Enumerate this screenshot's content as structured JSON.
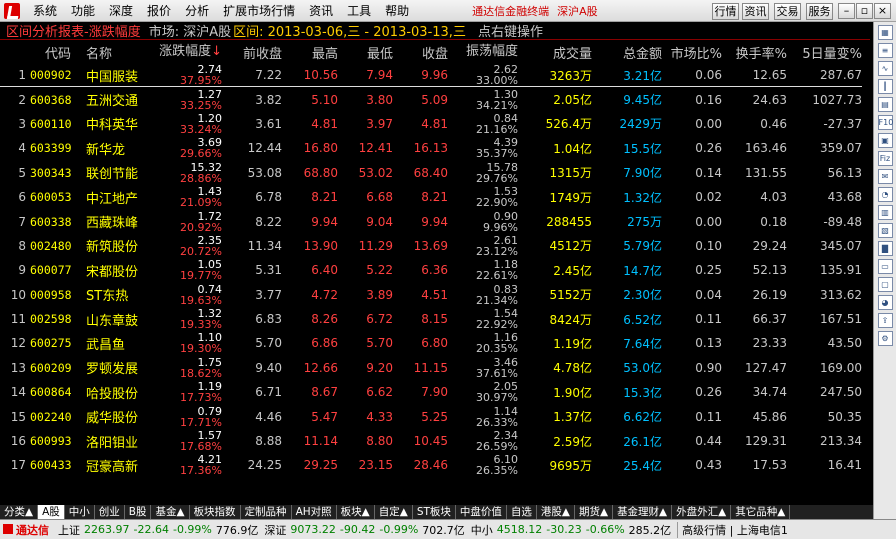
{
  "menu": {
    "items": [
      "系统",
      "功能",
      "深度",
      "报价",
      "分析",
      "扩展市场行情",
      "资讯",
      "工具",
      "帮助"
    ],
    "brand": "通达信金融终端",
    "market": "深沪A股",
    "buttons": [
      "行情",
      "资讯",
      "交易",
      "服务"
    ]
  },
  "title": {
    "main": "区间分析报表-涨跌幅度",
    "market": "市场: 深沪A股",
    "range": "区间: 2013-03-06,三 - 2013-03-13,三",
    "hint": "点右键操作"
  },
  "columns": {
    "code": "代码",
    "name": "名称",
    "pct": "涨跌幅度",
    "prev": "前收盘",
    "high": "最高",
    "low": "最低",
    "close": "收盘",
    "amp": "振荡幅度",
    "vol": "成交量",
    "amt": "总金额",
    "mkt": "市场比%",
    "turn": "换手率%",
    "d5": "5日量变%"
  },
  "rows": [
    {
      "idx": "1",
      "code": "000902",
      "name": "中国服装",
      "chg": "2.74",
      "pct": "37.95%",
      "prev": "7.22",
      "high": "10.56",
      "low": "7.94",
      "close": "9.96",
      "amp_abs": "2.62",
      "amp": "33.00%",
      "vol": "3263万",
      "amt": "3.21亿",
      "mkt": "0.06",
      "turn": "12.65",
      "d5": "287.67"
    },
    {
      "idx": "2",
      "code": "600368",
      "name": "五洲交通",
      "chg": "1.27",
      "pct": "33.25%",
      "prev": "3.82",
      "high": "5.10",
      "low": "3.80",
      "close": "5.09",
      "amp_abs": "1.30",
      "amp": "34.21%",
      "vol": "2.05亿",
      "amt": "9.45亿",
      "mkt": "0.16",
      "turn": "24.63",
      "d5": "1027.73"
    },
    {
      "idx": "3",
      "code": "600110",
      "name": "中科英华",
      "chg": "1.20",
      "pct": "33.24%",
      "prev": "3.61",
      "high": "4.81",
      "low": "3.97",
      "close": "4.81",
      "amp_abs": "0.84",
      "amp": "21.16%",
      "vol": "526.4万",
      "amt": "2429万",
      "mkt": "0.00",
      "turn": "0.46",
      "d5": "-27.37"
    },
    {
      "idx": "4",
      "code": "603399",
      "name": "新华龙",
      "chg": "3.69",
      "pct": "29.66%",
      "prev": "12.44",
      "high": "16.80",
      "low": "12.41",
      "close": "16.13",
      "amp_abs": "4.39",
      "amp": "35.37%",
      "vol": "1.04亿",
      "amt": "15.5亿",
      "mkt": "0.26",
      "turn": "163.46",
      "d5": "359.07"
    },
    {
      "idx": "5",
      "code": "300343",
      "name": "联创节能",
      "chg": "15.32",
      "pct": "28.86%",
      "prev": "53.08",
      "high": "68.80",
      "low": "53.02",
      "close": "68.40",
      "amp_abs": "15.78",
      "amp": "29.76%",
      "vol": "1315万",
      "amt": "7.90亿",
      "mkt": "0.14",
      "turn": "131.55",
      "d5": "56.13"
    },
    {
      "idx": "6",
      "code": "600053",
      "name": "中江地产",
      "chg": "1.43",
      "pct": "21.09%",
      "prev": "6.78",
      "high": "8.21",
      "low": "6.68",
      "close": "8.21",
      "amp_abs": "1.53",
      "amp": "22.90%",
      "vol": "1749万",
      "amt": "1.32亿",
      "mkt": "0.02",
      "turn": "4.03",
      "d5": "43.68"
    },
    {
      "idx": "7",
      "code": "600338",
      "name": "西藏珠峰",
      "chg": "1.72",
      "pct": "20.92%",
      "prev": "8.22",
      "high": "9.94",
      "low": "9.04",
      "close": "9.94",
      "amp_abs": "0.90",
      "amp": "9.96%",
      "vol": "288455",
      "amt": "275万",
      "mkt": "0.00",
      "turn": "0.18",
      "d5": "-89.48"
    },
    {
      "idx": "8",
      "code": "002480",
      "name": "新筑股份",
      "chg": "2.35",
      "pct": "20.72%",
      "prev": "11.34",
      "high": "13.90",
      "low": "11.29",
      "close": "13.69",
      "amp_abs": "2.61",
      "amp": "23.12%",
      "vol": "4512万",
      "amt": "5.79亿",
      "mkt": "0.10",
      "turn": "29.24",
      "d5": "345.07"
    },
    {
      "idx": "9",
      "code": "600077",
      "name": "宋都股份",
      "chg": "1.05",
      "pct": "19.77%",
      "prev": "5.31",
      "high": "6.40",
      "low": "5.22",
      "close": "6.36",
      "amp_abs": "1.18",
      "amp": "22.61%",
      "vol": "2.45亿",
      "amt": "14.7亿",
      "mkt": "0.25",
      "turn": "52.13",
      "d5": "135.91"
    },
    {
      "idx": "10",
      "code": "000958",
      "name": "ST东热",
      "chg": "0.74",
      "pct": "19.63%",
      "prev": "3.77",
      "high": "4.72",
      "low": "3.89",
      "close": "4.51",
      "amp_abs": "0.83",
      "amp": "21.34%",
      "vol": "5152万",
      "amt": "2.30亿",
      "mkt": "0.04",
      "turn": "26.19",
      "d5": "313.62"
    },
    {
      "idx": "11",
      "code": "002598",
      "name": "山东章鼓",
      "chg": "1.32",
      "pct": "19.33%",
      "prev": "6.83",
      "high": "8.26",
      "low": "6.72",
      "close": "8.15",
      "amp_abs": "1.54",
      "amp": "22.92%",
      "vol": "8424万",
      "amt": "6.52亿",
      "mkt": "0.11",
      "turn": "66.37",
      "d5": "167.51"
    },
    {
      "idx": "12",
      "code": "600275",
      "name": "武昌鱼",
      "chg": "1.10",
      "pct": "19.30%",
      "prev": "5.70",
      "high": "6.86",
      "low": "5.70",
      "close": "6.80",
      "amp_abs": "1.16",
      "amp": "20.35%",
      "vol": "1.19亿",
      "amt": "7.64亿",
      "mkt": "0.13",
      "turn": "23.33",
      "d5": "43.50"
    },
    {
      "idx": "13",
      "code": "600209",
      "name": "罗顿发展",
      "chg": "1.75",
      "pct": "18.62%",
      "prev": "9.40",
      "high": "12.66",
      "low": "9.20",
      "close": "11.15",
      "amp_abs": "3.46",
      "amp": "37.61%",
      "vol": "4.78亿",
      "amt": "53.0亿",
      "mkt": "0.90",
      "turn": "127.47",
      "d5": "169.00"
    },
    {
      "idx": "14",
      "code": "600864",
      "name": "哈投股份",
      "chg": "1.19",
      "pct": "17.73%",
      "prev": "6.71",
      "high": "8.67",
      "low": "6.62",
      "close": "7.90",
      "amp_abs": "2.05",
      "amp": "30.97%",
      "vol": "1.90亿",
      "amt": "15.3亿",
      "mkt": "0.26",
      "turn": "34.74",
      "d5": "247.50"
    },
    {
      "idx": "15",
      "code": "002240",
      "name": "威华股份",
      "chg": "0.79",
      "pct": "17.71%",
      "prev": "4.46",
      "high": "5.47",
      "low": "4.33",
      "close": "5.25",
      "amp_abs": "1.14",
      "amp": "26.33%",
      "vol": "1.37亿",
      "amt": "6.62亿",
      "mkt": "0.11",
      "turn": "45.86",
      "d5": "50.35"
    },
    {
      "idx": "16",
      "code": "600993",
      "name": "洛阳钼业",
      "chg": "1.57",
      "pct": "17.68%",
      "prev": "8.88",
      "high": "11.14",
      "low": "8.80",
      "close": "10.45",
      "amp_abs": "2.34",
      "amp": "26.59%",
      "vol": "2.59亿",
      "amt": "26.1亿",
      "mkt": "0.44",
      "turn": "129.31",
      "d5": "213.34"
    },
    {
      "idx": "17",
      "code": "600433",
      "name": "冠豪高新",
      "chg": "4.21",
      "pct": "17.36%",
      "prev": "24.25",
      "high": "29.25",
      "low": "23.15",
      "close": "28.46",
      "amp_abs": "6.10",
      "amp": "26.35%",
      "vol": "9695万",
      "amt": "25.4亿",
      "mkt": "0.43",
      "turn": "17.53",
      "d5": "16.41"
    }
  ],
  "tabs": [
    "分类▲",
    "A股",
    "中小",
    "创业",
    "B股",
    "基金▲",
    "板块指数",
    "定制品种",
    "AH对照",
    "板块▲",
    "自定▲",
    "ST板块",
    "中盘价值",
    "自选",
    "港股▲",
    "期货▲",
    "基金理财▲",
    "外盘外汇▲",
    "其它品种▲"
  ],
  "status": {
    "brand": "通达信",
    "sh_label": "上证",
    "sh_val": "2263.97",
    "sh_chg": "-22.64",
    "sh_pct": "-0.99%",
    "sh_amt": "776.9亿",
    "sz_label": "深证",
    "sz_val": "9073.22",
    "sz_chg": "-90.42",
    "sz_pct": "-0.99%",
    "sz_amt": "702.7亿",
    "zx_label": "中小",
    "zx_val": "4518.12",
    "zx_chg": "-30.23",
    "zx_pct": "-0.66%",
    "zx_amt": "285.2亿",
    "right": "高级行情 | 上海电信1"
  },
  "colors": {
    "up": "#ff4040",
    "code": "#ffff00",
    "amount": "#00c0ff",
    "bg": "#000000"
  }
}
